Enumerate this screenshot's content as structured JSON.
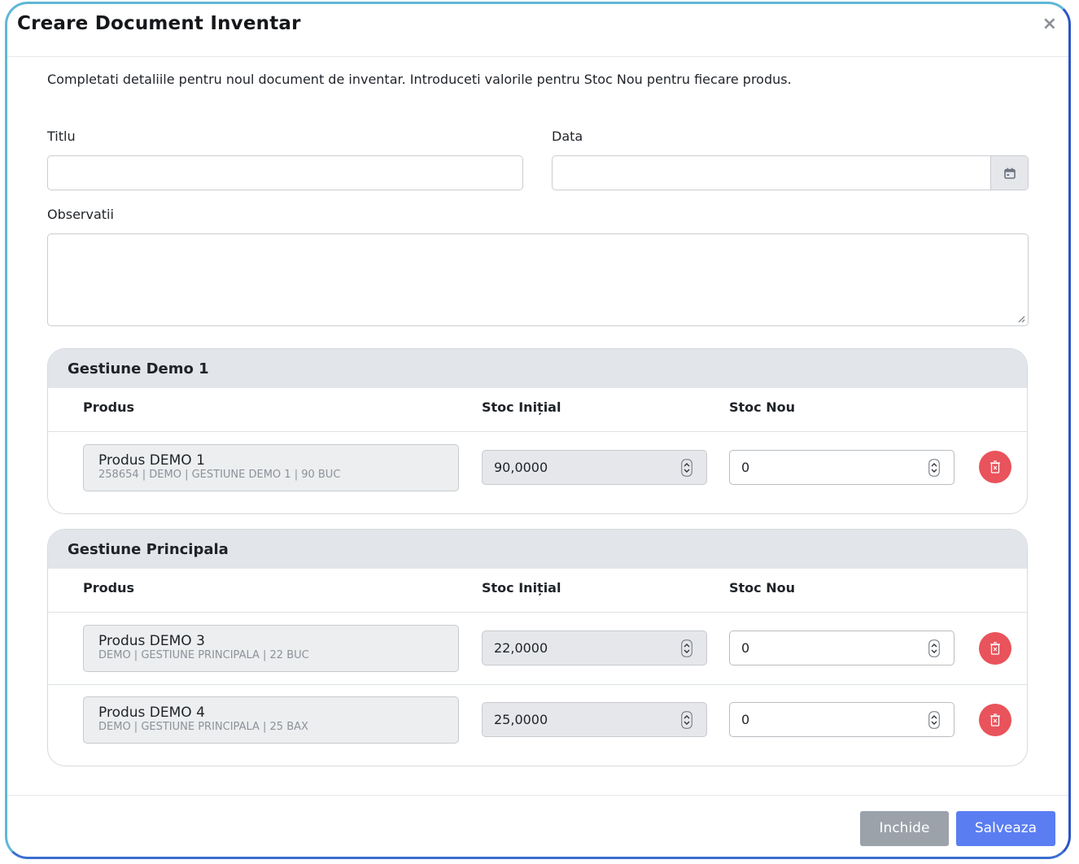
{
  "dialog": {
    "title": "Creare Document Inventar",
    "close_symbol": "×",
    "description": "Completati detaliile pentru noul document de inventar. Introduceti valorile pentru Stoc Nou pentru fiecare produs."
  },
  "form": {
    "titlu_label": "Titlu",
    "titlu_value": "",
    "data_label": "Data",
    "data_value": "",
    "observatii_label": "Observatii",
    "observatii_value": ""
  },
  "table_headers": {
    "produs": "Produs",
    "stoc_initial": "Stoc Inițial",
    "stoc_nou": "Stoc Nou"
  },
  "sections": [
    {
      "name": "Gestiune Demo 1",
      "rows": [
        {
          "product": "Produs DEMO 1",
          "meta": "258654 | DEMO | GESTIUNE DEMO 1 | 90 BUC",
          "stoc_initial": "90,0000",
          "stoc_nou": "0"
        }
      ]
    },
    {
      "name": "Gestiune Principala",
      "rows": [
        {
          "product": "Produs DEMO 3",
          "meta": "DEMO | GESTIUNE PRINCIPALA | 22 BUC",
          "stoc_initial": "22,0000",
          "stoc_nou": "0"
        },
        {
          "product": "Produs DEMO 4",
          "meta": "DEMO | GESTIUNE PRINCIPALA | 25 BAX",
          "stoc_initial": "25,0000",
          "stoc_nou": "0"
        }
      ]
    }
  ],
  "buttons": {
    "close": "Inchide",
    "save": "Salveaza"
  },
  "icons": {
    "close": "close-icon",
    "calendar": "calendar-icon",
    "delete": "trash-icon",
    "spinner": "spinner-arrows-icon"
  },
  "colors": {
    "delete": "#e9535b",
    "save": "#5a7df2",
    "close_button": "#9ca2aa",
    "section_header": "#e2e5e9"
  }
}
